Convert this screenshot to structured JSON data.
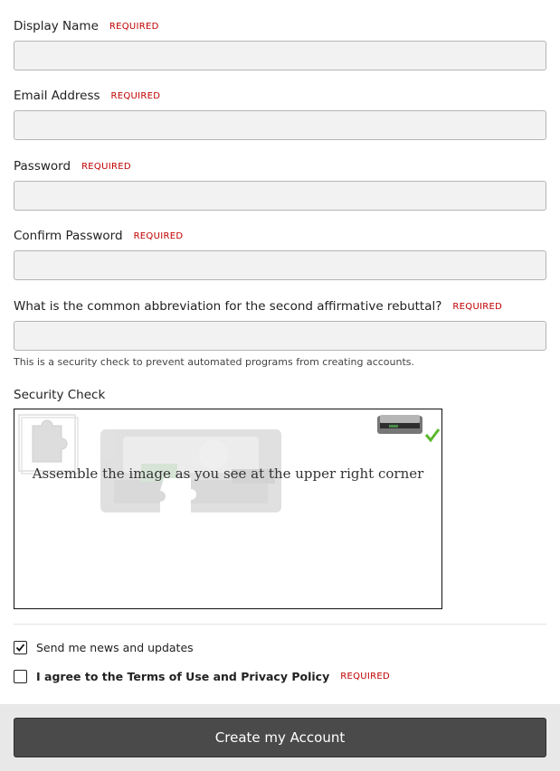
{
  "required_label": "REQUIRED",
  "fields": {
    "display_name": {
      "label": "Display Name",
      "value": ""
    },
    "email": {
      "label": "Email Address",
      "value": ""
    },
    "password": {
      "label": "Password",
      "value": ""
    },
    "confirm_password": {
      "label": "Confirm Password",
      "value": ""
    },
    "security_question": {
      "label": "What is the common abbreviation for the second affirmative rebuttal?",
      "value": "",
      "hint": "This is a security check to prevent automated programs from creating accounts."
    }
  },
  "security_check": {
    "label": "Security Check",
    "instruction": "Assemble the image as you see at the upper right corner",
    "reference_image": "hard-drive",
    "status_icon": "check-icon"
  },
  "options": {
    "news": {
      "label": "Send me news and updates",
      "checked": true
    },
    "terms": {
      "label": "I agree to the Terms of Use and Privacy Policy",
      "checked": false
    }
  },
  "submit_label": "Create my Account",
  "colors": {
    "required": "#c00000",
    "button": "#4a4a4a",
    "check": "#5cb82e"
  }
}
